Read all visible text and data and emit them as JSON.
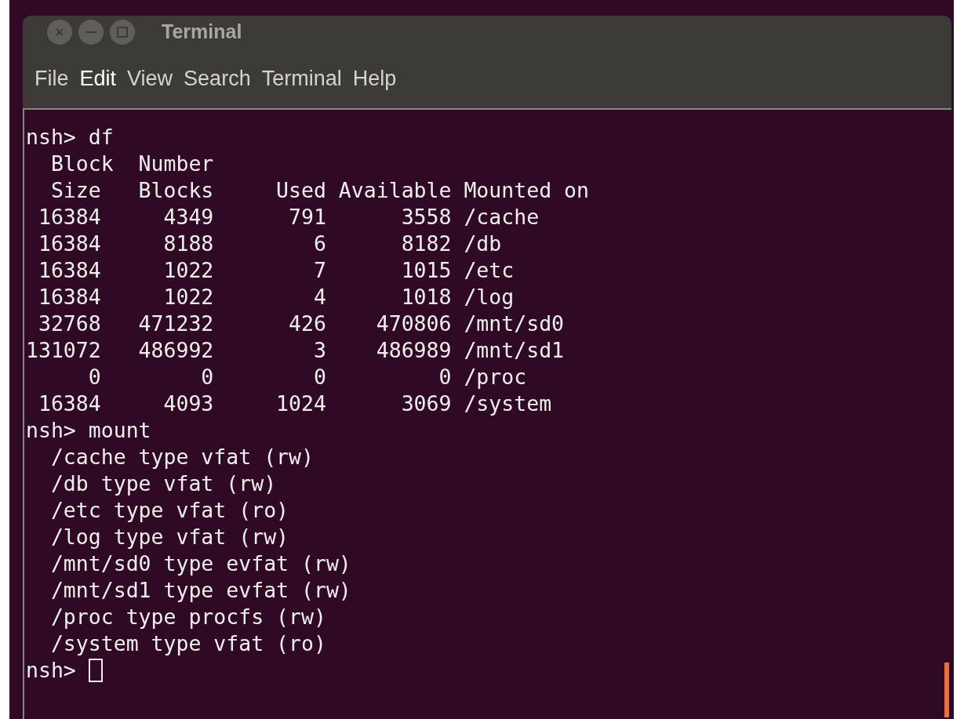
{
  "window": {
    "title": "Terminal"
  },
  "menu": [
    {
      "label": "File",
      "selected": false
    },
    {
      "label": "Edit",
      "selected": true
    },
    {
      "label": "View",
      "selected": false
    },
    {
      "label": "Search",
      "selected": false
    },
    {
      "label": "Terminal",
      "selected": false
    },
    {
      "label": "Help",
      "selected": false
    }
  ],
  "terminal": {
    "lines": [
      "nsh> df",
      "  Block  Number",
      "  Size   Blocks     Used Available Mounted on",
      " 16384     4349      791      3558 /cache",
      " 16384     8188        6      8182 /db",
      " 16384     1022        7      1015 /etc",
      " 16384     1022        4      1018 /log",
      " 32768   471232      426    470806 /mnt/sd0",
      "131072   486992        3    486989 /mnt/sd1",
      "     0        0        0         0 /proc",
      " 16384     4093     1024      3069 /system",
      "nsh> mount",
      "  /cache type vfat (rw)",
      "  /db type vfat (rw)",
      "  /etc type vfat (ro)",
      "  /log type vfat (rw)",
      "  /mnt/sd0 type evfat (rw)",
      "  /mnt/sd1 type evfat (rw)",
      "  /proc type procfs (rw)",
      "  /system type vfat (ro)"
    ],
    "prompt": "nsh>"
  }
}
